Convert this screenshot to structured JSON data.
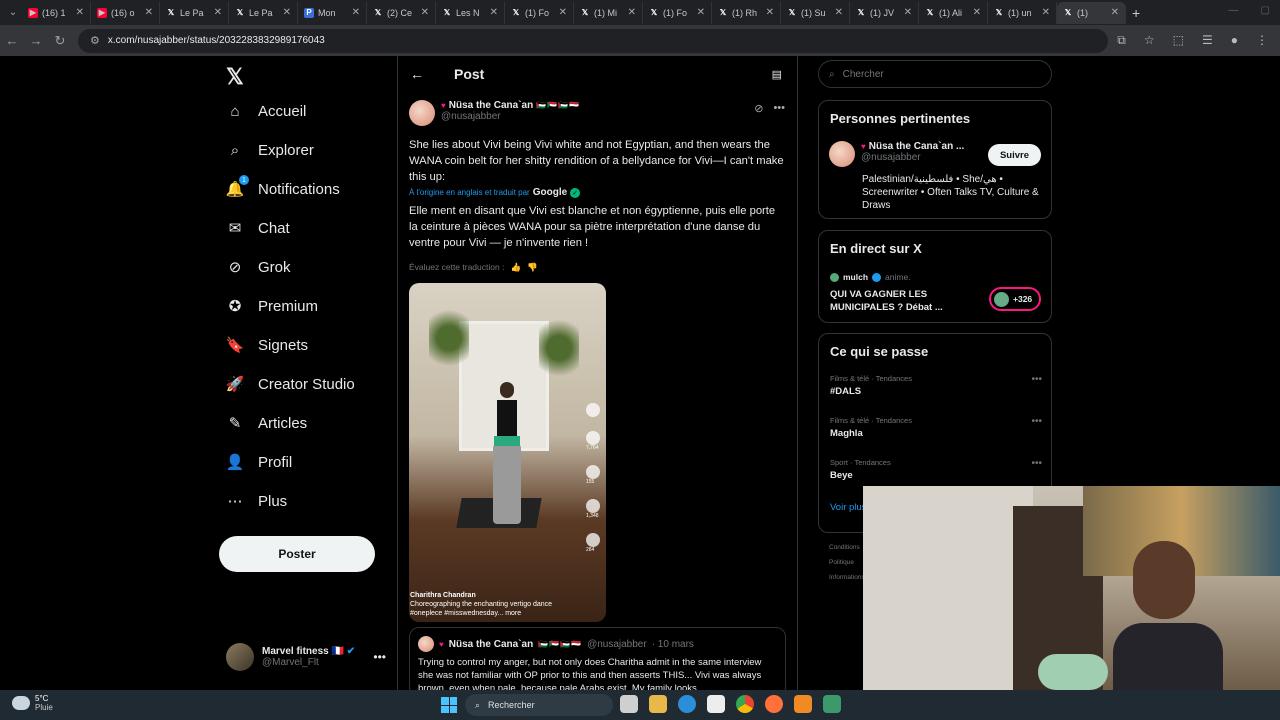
{
  "browser": {
    "tabs": [
      {
        "title": "(16) 1",
        "icon": "youtube-icon"
      },
      {
        "title": "(16) o",
        "icon": "youtube-icon"
      },
      {
        "title": "Le Pa",
        "icon": "x-icon"
      },
      {
        "title": "Le Pa",
        "icon": "x-icon"
      },
      {
        "title": "Mon",
        "icon": "letter-icon"
      },
      {
        "title": "(2) Ce",
        "icon": "x-icon"
      },
      {
        "title": "Les N",
        "icon": "x-icon"
      },
      {
        "title": "(1) Fo",
        "icon": "x-icon"
      },
      {
        "title": "(1) Mi",
        "icon": "x-icon"
      },
      {
        "title": "(1) Fo",
        "icon": "x-icon"
      },
      {
        "title": "(1) Rh",
        "icon": "x-icon"
      },
      {
        "title": "(1) Su",
        "icon": "x-icon"
      },
      {
        "title": "(1) JV",
        "icon": "x-icon"
      },
      {
        "title": "(1) Ali",
        "icon": "x-icon"
      },
      {
        "title": "(1) un",
        "icon": "x-icon"
      },
      {
        "title": "(1)",
        "icon": "x-icon"
      }
    ],
    "url": "x.com/nusajabber/status/2032283832989176043"
  },
  "nav": {
    "items": [
      {
        "label": "Accueil",
        "icon": "home-icon"
      },
      {
        "label": "Explorer",
        "icon": "search-icon"
      },
      {
        "label": "Notifications",
        "icon": "bell-icon",
        "badge": "1"
      },
      {
        "label": "Chat",
        "icon": "mail-icon"
      },
      {
        "label": "Grok",
        "icon": "grok-icon"
      },
      {
        "label": "Premium",
        "icon": "premium-icon"
      },
      {
        "label": "Signets",
        "icon": "bookmark-icon"
      },
      {
        "label": "Creator Studio",
        "icon": "rocket-icon"
      },
      {
        "label": "Articles",
        "icon": "article-icon"
      },
      {
        "label": "Profil",
        "icon": "person-icon"
      },
      {
        "label": "Plus",
        "icon": "more-circle-icon"
      }
    ],
    "post_label": "Poster",
    "account": {
      "name": "Marvel fitness",
      "flag": "🇫🇷",
      "handle": "@Marvel_Flt"
    }
  },
  "post": {
    "header_title": "Post",
    "author_name": "Nüsa the Cana`an",
    "author_flags": "🇵🇸🇸🇩🇵🇸🇾🇪",
    "author_handle": "@nusajabber",
    "text": "She lies about Vivi being Vivi white and not Egyptian, and then wears the WANA coin belt for her shitty rendition of a bellydance for Vivi—I can't make this up:",
    "translated_note": "À l'origine en anglais et traduit par",
    "translated_brand": "Google",
    "translation": "Elle ment en disant que Vivi est blanche et non égyptienne, puis elle porte la ceinture à pièces WANA pour sa piètre interprétation d'une danse du ventre pour Vivi — je n'invente rien !",
    "rate_label": "Évaluez cette traduction :",
    "media": {
      "counts": [
        "7,764",
        "155",
        "1,348",
        "284"
      ],
      "caption_user": "Charithra Chandran",
      "caption_text": "Choreographing the enchanting vertigo dance #oneplece #misswednesday... more"
    }
  },
  "reply": {
    "name": "Nüsa the Cana`an",
    "flags": "🇵🇸🇸🇩🇵🇸🇾🇪",
    "handle": "@nusajabber",
    "date": "· 10 mars",
    "text": "Trying to control my anger, but not only does Charitha admit in the same interview she was not familiar with OP prior to this and then asserts THIS... Vivi was always brown, even when pale, because pale Arabs exist. My family looks..."
  },
  "right": {
    "search_placeholder": "Chercher",
    "people_title": "Personnes pertinentes",
    "person_name": "Nüsa the Cana`an ...",
    "person_handle": "@nusajabber",
    "follow_label": "Suivre",
    "person_bio": "Palestinian/فلسطينية • She/هي • Screenwriter • Often Talks TV, Culture & Draws",
    "live_title": "En direct sur X",
    "live_user": "mulch",
    "live_action": "anime.",
    "live_text": "QUI VA GAGNER LES MUNICIPALES ? Débat ...",
    "live_count": "+326",
    "trends_title": "Ce qui se passe",
    "trends": [
      {
        "category": "Films & télé · Tendances",
        "name": "#DALS"
      },
      {
        "category": "Films & télé · Tendances",
        "name": "Maghla"
      },
      {
        "category": "Sport · Tendances",
        "name": "Beye"
      }
    ],
    "see_more": "Voir plus",
    "footer": [
      "Conditions",
      "Politique",
      "Informations"
    ]
  },
  "taskbar": {
    "temp": "5°C",
    "weather": "Pluie",
    "search_label": "Rechercher"
  },
  "colors": {
    "accent": "#1d9bf0",
    "like": "#f91880",
    "verified": "#00ba7c",
    "bg": "#000000"
  }
}
